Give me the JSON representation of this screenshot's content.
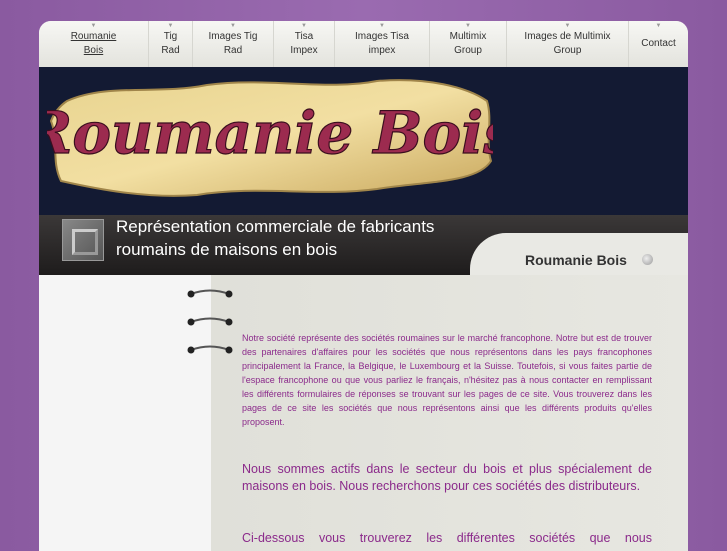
{
  "nav": {
    "items": [
      {
        "label": "Roumanie\nBois",
        "active": true
      },
      {
        "label": "Tig\nRad"
      },
      {
        "label": "Images Tig\nRad"
      },
      {
        "label": "Tisa\nImpex"
      },
      {
        "label": "Images Tisa\nimpex"
      },
      {
        "label": "Multimix\nGroup"
      },
      {
        "label": "Images de Multimix\nGroup"
      },
      {
        "label": "Contact"
      }
    ]
  },
  "header": {
    "logo_text": "Roumanie Bois",
    "tagline": "Représentation commerciale de fabricants roumains de maisons en bois"
  },
  "tab": {
    "title": "Roumanie Bois"
  },
  "content": {
    "p1": "Notre société représente des sociétés roumaines sur le marché francophone.  Notre but est de trouver des partenaires d'affaires pour les sociétés que nous représentons dans les pays francophones principalement la France, la Belgique, le Luxembourg et la Suisse.  Toutefois, si vous faites partie de l'espace francophone ou que vous parliez le français, n'hésitez pas à nous contacter en remplissant les différents formulaires de réponses se trouvant sur les pages de ce site.  Vous trouverez dans les pages de ce site les sociétés que nous représentons ainsi que les différents produits qu'elles proposent.",
    "p2": "Nous sommes actifs dans le secteur du bois et plus spécialement de maisons en bois.  Nous recherchons pour ces sociétés des distributeurs.",
    "p3": "Ci-dessous vous trouverez les différentes sociétés que nous"
  },
  "colors": {
    "background": "#9a6bb0",
    "header": "#131a33",
    "text": "#8b2a8b"
  }
}
